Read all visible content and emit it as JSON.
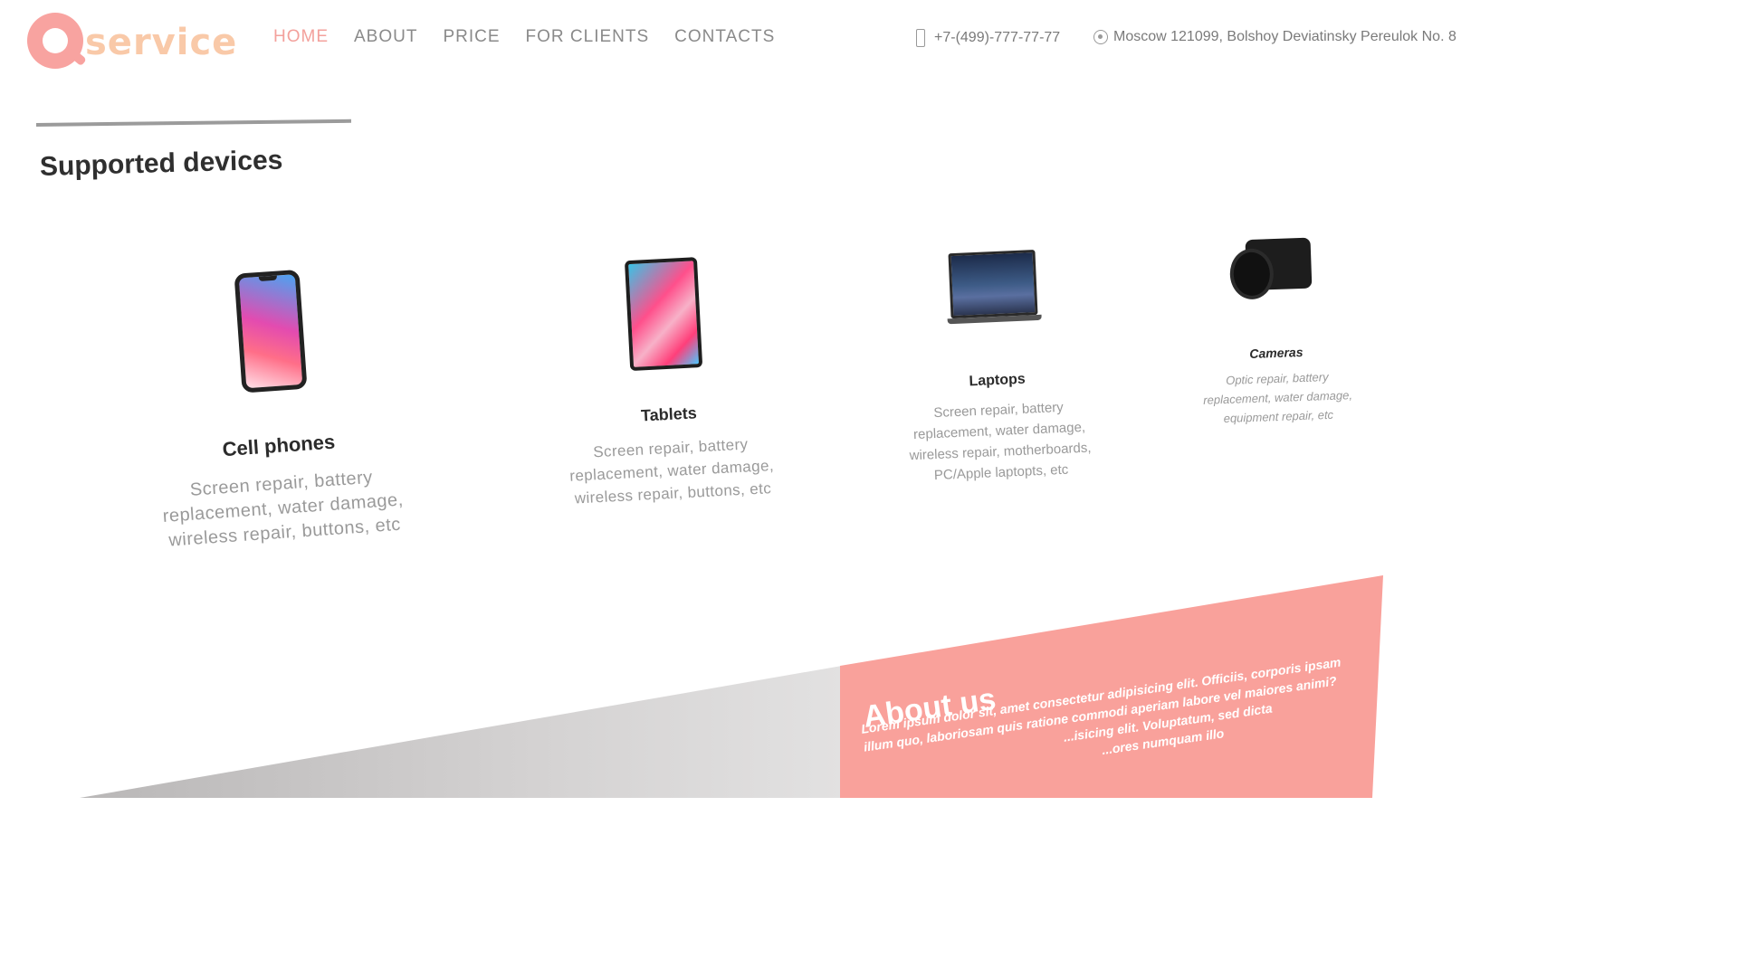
{
  "brand": {
    "logo_text": "Qservice"
  },
  "nav": {
    "items": [
      "HOME",
      "ABOUT",
      "PRICE",
      "FOR CLIENTS",
      "CONTACTS"
    ],
    "active": "HOME"
  },
  "contacts": {
    "phone": "+7-(499)-777-77-77",
    "address": "Moscow 121099, Bolshoy Deviatinsky Pereulok No. 8"
  },
  "section": {
    "title": "Supported devices"
  },
  "devices": [
    {
      "name": "Cell phones",
      "desc": "Screen repair, battery replacement, water damage, wireless repair, buttons, etc"
    },
    {
      "name": "Tablets",
      "desc": "Screen repair, battery replacement, water damage, wireless repair, buttons, etc"
    },
    {
      "name": "Laptops",
      "desc": "Screen repair, battery replacement, water damage, wireless repair, motherboards, PC/Apple laptopts, etc"
    },
    {
      "name": "Cameras",
      "desc": "Optic repair, battery replacement, water damage, equipment repair, etc"
    }
  ],
  "about": {
    "title": "About us",
    "lines": [
      "Lorem ipsum dolor sit, amet consectetur adipisicing elit. Officiis, corporis ipsam",
      "illum quo, laboriosam quis ratione commodi aperiam labore vel maiores animi?",
      "...isicing elit. Voluptatum, sed dicta",
      "...ores numquam illo"
    ]
  },
  "colors": {
    "accent": "#f9a19b",
    "nav_active": "#f3a19c"
  }
}
